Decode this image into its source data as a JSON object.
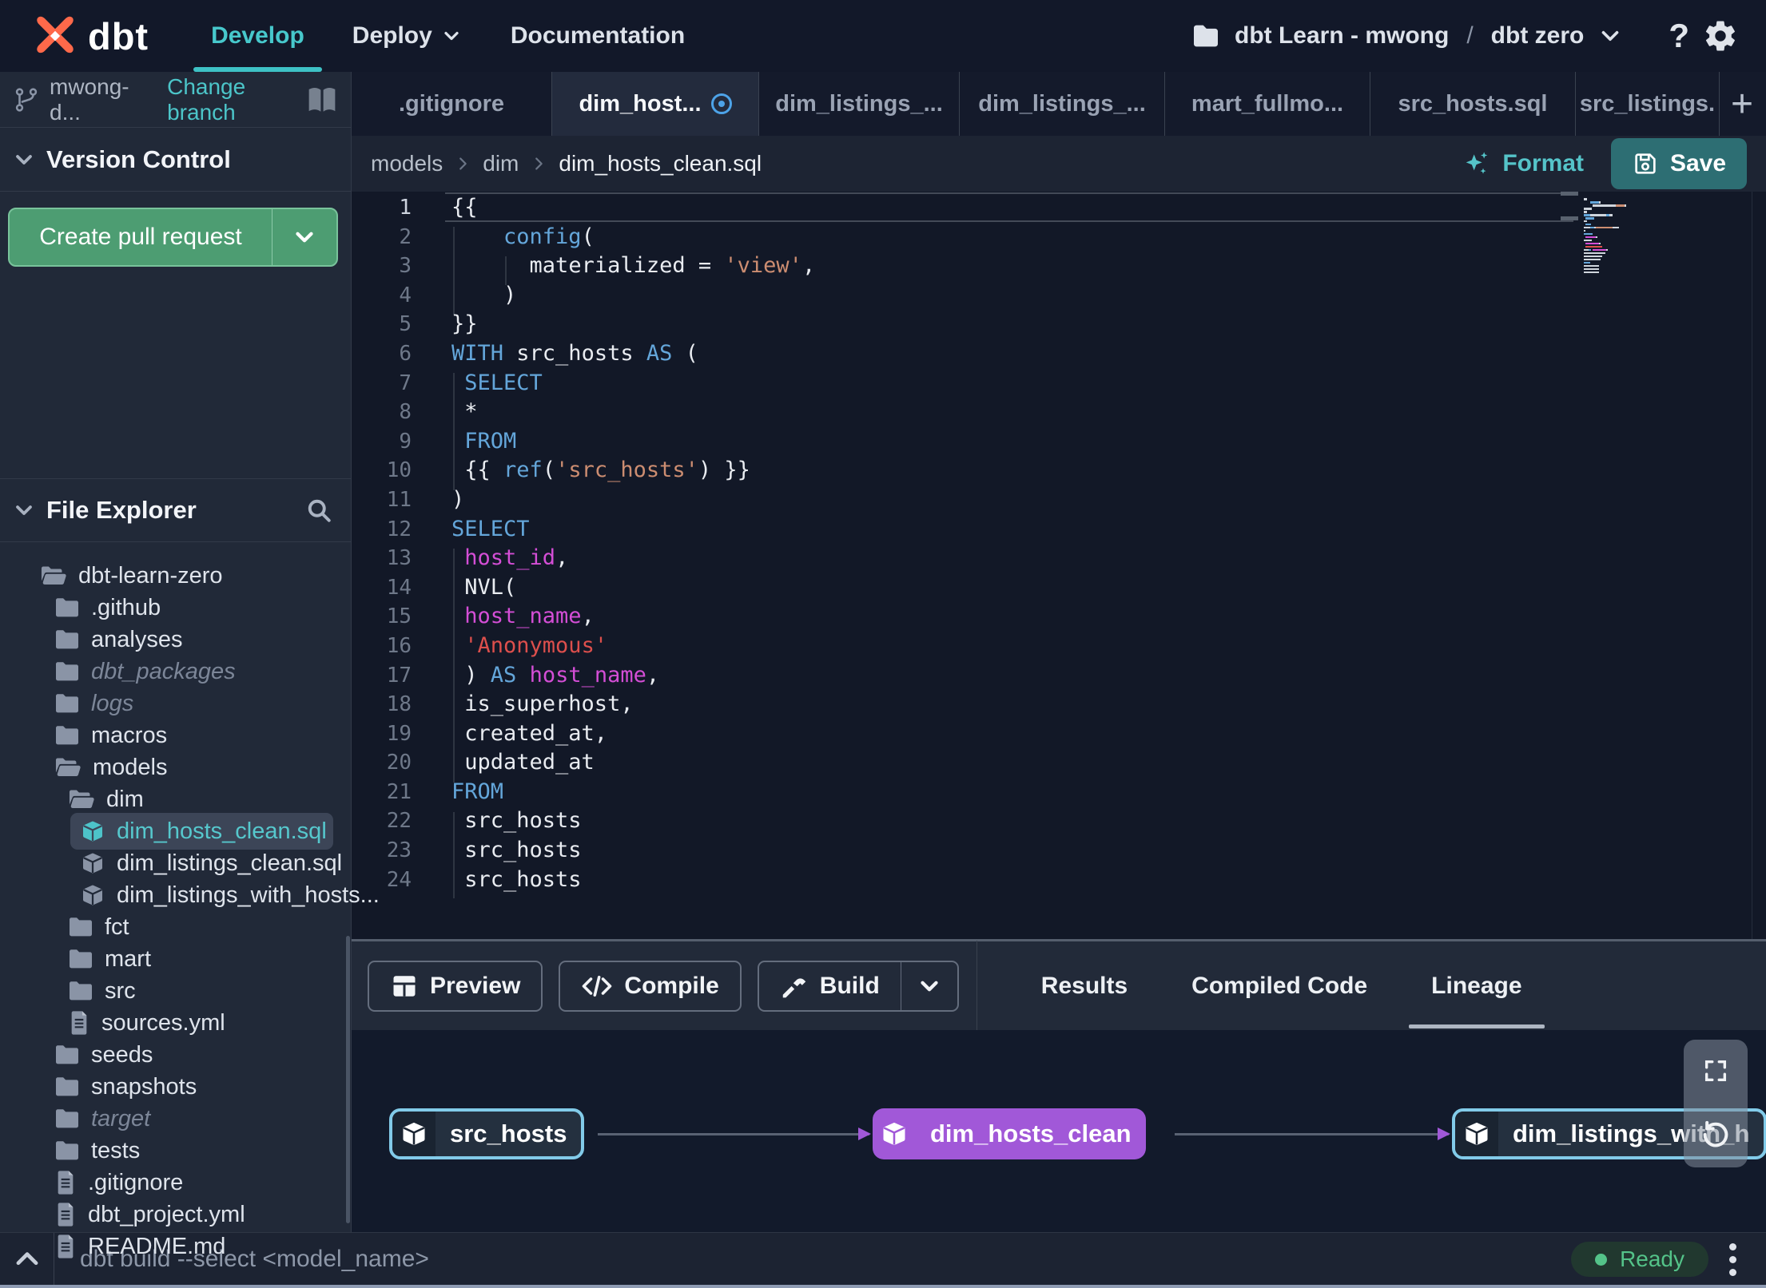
{
  "colors": {
    "accent_teal": "#4cc5c9",
    "green_button": "#4d9d72",
    "save_teal": "#2d6e73",
    "node_cyan": "#82cbe9",
    "node_purple": "#a158d8",
    "ready_green": "#54c389",
    "keyword_blue": "#64a6da",
    "string_orange": "#cc8d71",
    "string_red": "#dd4f4c",
    "field_magenta": "#d44ed6"
  },
  "topbar": {
    "brand": "dbt",
    "nav": [
      {
        "label": "Develop",
        "active": true,
        "chevron": false
      },
      {
        "label": "Deploy",
        "active": false,
        "chevron": true
      },
      {
        "label": "Documentation",
        "active": false,
        "chevron": false
      }
    ],
    "project": {
      "label": "dbt Learn - mwong",
      "slash": "/",
      "env": "dbt zero",
      "help": "?"
    }
  },
  "sidebar": {
    "branch": {
      "name": "mwong-d...",
      "action": "Change branch"
    },
    "version_control": {
      "title": "Version Control",
      "button": "Create pull request"
    },
    "file_explorer": {
      "title": "File Explorer",
      "tree": [
        {
          "label": "dbt-learn-zero",
          "icon": "folder-open",
          "level": 1
        },
        {
          "label": ".github",
          "icon": "folder",
          "level": 2
        },
        {
          "label": "analyses",
          "icon": "folder",
          "level": 2
        },
        {
          "label": "dbt_packages",
          "icon": "folder",
          "level": 2,
          "italic": true
        },
        {
          "label": "logs",
          "icon": "folder",
          "level": 2,
          "italic": true
        },
        {
          "label": "macros",
          "icon": "folder",
          "level": 2
        },
        {
          "label": "models",
          "icon": "folder-open",
          "level": 2
        },
        {
          "label": "dim",
          "icon": "folder-open",
          "level": 3
        },
        {
          "label": "dim_hosts_clean.sql",
          "icon": "model",
          "level": 4,
          "selected": true,
          "modified": true
        },
        {
          "label": "dim_listings_clean.sql",
          "icon": "model",
          "level": 4
        },
        {
          "label": "dim_listings_with_hosts...",
          "icon": "model",
          "level": 4
        },
        {
          "label": "fct",
          "icon": "folder",
          "level": 3
        },
        {
          "label": "mart",
          "icon": "folder",
          "level": 3
        },
        {
          "label": "src",
          "icon": "folder",
          "level": 3
        },
        {
          "label": "sources.yml",
          "icon": "file",
          "level": 3
        },
        {
          "label": "seeds",
          "icon": "folder",
          "level": 2
        },
        {
          "label": "snapshots",
          "icon": "folder",
          "level": 2
        },
        {
          "label": "target",
          "icon": "folder",
          "level": 2,
          "italic": true
        },
        {
          "label": "tests",
          "icon": "folder",
          "level": 2
        },
        {
          "label": ".gitignore",
          "icon": "file",
          "level": 2
        },
        {
          "label": "dbt_project.yml",
          "icon": "file",
          "level": 2
        },
        {
          "label": "README.md",
          "icon": "file",
          "level": 2
        }
      ]
    }
  },
  "tabs": {
    "items": [
      {
        "label": ".gitignore"
      },
      {
        "label": "dim_host...",
        "active": true,
        "modified": true
      },
      {
        "label": "dim_listings_..."
      },
      {
        "label": "dim_listings_..."
      },
      {
        "label": "mart_fullmo..."
      },
      {
        "label": "src_hosts.sql"
      },
      {
        "label": "src_listings."
      }
    ],
    "new_tab": "+"
  },
  "breadcrumb": {
    "items": [
      "models",
      "dim",
      "dim_hosts_clean.sql"
    ],
    "format_label": "Format",
    "save_label": "Save"
  },
  "editor": {
    "current_line": 1,
    "lines": [
      {
        "n": 1,
        "segs": [
          [
            "{{",
            "pl"
          ]
        ]
      },
      {
        "n": 2,
        "segs": [
          [
            "    ",
            "pl"
          ],
          [
            "config",
            "kw"
          ],
          [
            "(",
            "pl"
          ]
        ]
      },
      {
        "n": 3,
        "segs": [
          [
            "      ",
            "pl"
          ],
          [
            "materialized = ",
            "pl"
          ],
          [
            "'view'",
            "st"
          ],
          [
            ",",
            "pl"
          ]
        ]
      },
      {
        "n": 4,
        "segs": [
          [
            "    )",
            "pl"
          ]
        ]
      },
      {
        "n": 5,
        "segs": [
          [
            "}}",
            "pl"
          ]
        ]
      },
      {
        "n": 6,
        "segs": [
          [
            "WITH",
            "kw"
          ],
          [
            " src_hosts ",
            "pl"
          ],
          [
            "AS",
            "kw"
          ],
          [
            " (",
            "pl"
          ]
        ]
      },
      {
        "n": 7,
        "segs": [
          [
            " ",
            "pl"
          ],
          [
            "SELECT",
            "kw"
          ]
        ]
      },
      {
        "n": 8,
        "segs": [
          [
            " *",
            "pl"
          ]
        ]
      },
      {
        "n": 9,
        "segs": [
          [
            " ",
            "pl"
          ],
          [
            "FROM",
            "kw"
          ]
        ]
      },
      {
        "n": 10,
        "segs": [
          [
            " {{ ",
            "pl"
          ],
          [
            "ref",
            "kw"
          ],
          [
            "(",
            "pl"
          ],
          [
            "'src_hosts'",
            "st"
          ],
          [
            ") }}",
            "pl"
          ]
        ]
      },
      {
        "n": 11,
        "segs": [
          [
            ")",
            "pl"
          ]
        ]
      },
      {
        "n": 12,
        "segs": [
          [
            "SELECT",
            "kw"
          ]
        ]
      },
      {
        "n": 13,
        "segs": [
          [
            " ",
            "pl"
          ],
          [
            "host_id",
            "fd"
          ],
          [
            ",",
            "pl"
          ]
        ]
      },
      {
        "n": 14,
        "segs": [
          [
            " NVL(",
            "pl"
          ]
        ]
      },
      {
        "n": 15,
        "segs": [
          [
            " ",
            "pl"
          ],
          [
            "host_name",
            "fd"
          ],
          [
            ",",
            "pl"
          ]
        ]
      },
      {
        "n": 16,
        "segs": [
          [
            " ",
            "pl"
          ],
          [
            "'Anonymous'",
            "s2"
          ]
        ]
      },
      {
        "n": 17,
        "segs": [
          [
            " ) ",
            "pl"
          ],
          [
            "AS",
            "kw"
          ],
          [
            " ",
            "pl"
          ],
          [
            "host_name",
            "fd"
          ],
          [
            ",",
            "pl"
          ]
        ]
      },
      {
        "n": 18,
        "segs": [
          [
            " is_superhost,",
            "pl"
          ]
        ]
      },
      {
        "n": 19,
        "segs": [
          [
            " created_at,",
            "pl"
          ]
        ]
      },
      {
        "n": 20,
        "segs": [
          [
            " updated_at",
            "pl"
          ]
        ]
      },
      {
        "n": 21,
        "segs": [
          [
            "FROM",
            "kw"
          ]
        ]
      },
      {
        "n": 22,
        "segs": [
          [
            " src_hosts",
            "pl"
          ]
        ]
      },
      {
        "n": 23,
        "segs": [
          [
            " src_hosts",
            "pl"
          ]
        ]
      },
      {
        "n": 24,
        "segs": [
          [
            " src_hosts",
            "pl"
          ]
        ]
      }
    ]
  },
  "panel": {
    "buttons": [
      {
        "label": "Preview",
        "icon": "table"
      },
      {
        "label": "Compile",
        "icon": "code"
      },
      {
        "label": "Build",
        "icon": "hammer",
        "split": true
      }
    ],
    "tabs": [
      {
        "label": "Results"
      },
      {
        "label": "Compiled Code"
      },
      {
        "label": "Lineage",
        "active": true
      }
    ]
  },
  "lineage": {
    "nodes": [
      {
        "label": "src_hosts",
        "type": "src"
      },
      {
        "label": "dim_hosts_clean",
        "type": "model"
      },
      {
        "label": "dim_listings_with_h",
        "type": "src"
      }
    ]
  },
  "bottombar": {
    "command": "dbt build --select <model_name>",
    "status": "Ready"
  }
}
